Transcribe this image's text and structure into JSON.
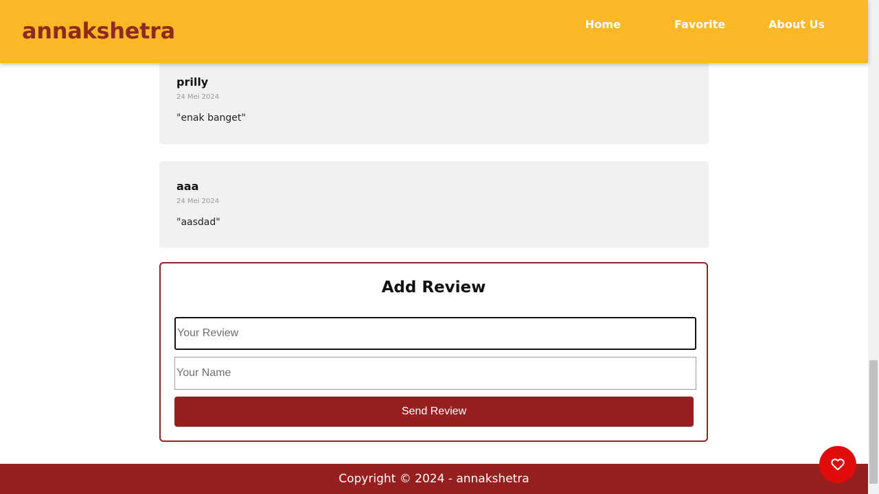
{
  "header": {
    "brand": "annakshetra",
    "nav": [
      {
        "label": "Home"
      },
      {
        "label": "Favorite"
      },
      {
        "label": "About Us"
      }
    ]
  },
  "reviews": [
    {
      "name": "prilly",
      "date": "24 Mei 2024",
      "text": "\"enak banget\""
    },
    {
      "name": "aaa",
      "date": "24 Mei 2024",
      "text": "\"aasdad\""
    }
  ],
  "form": {
    "title": "Add Review",
    "review_placeholder": "Your Review",
    "review_value": "",
    "name_placeholder": "Your Name",
    "name_value": "",
    "submit_label": "Send Review"
  },
  "footer": {
    "text": "Copyright © 2024 - annakshetra"
  },
  "fab": {
    "icon": "heart-icon"
  },
  "colors": {
    "header_bg": "#fbb826",
    "brand": "#8e2a1e",
    "accent": "#96201f",
    "fab": "#e00b0b"
  }
}
